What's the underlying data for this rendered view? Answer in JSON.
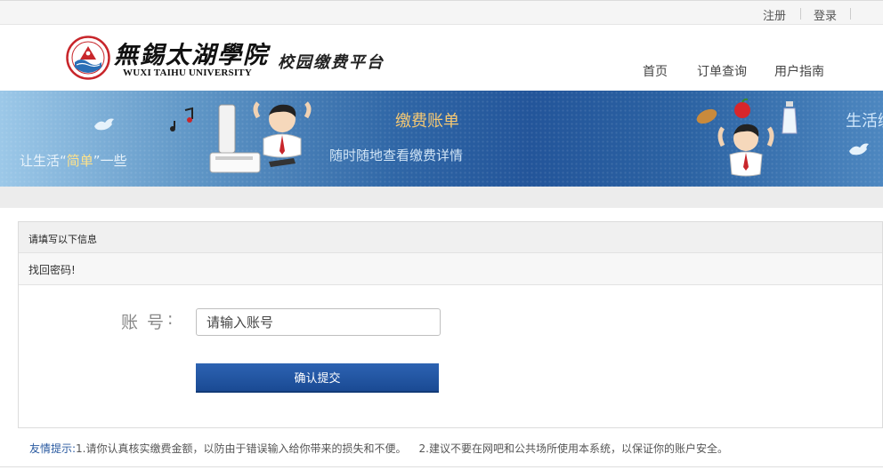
{
  "topbar": {
    "register": "注册",
    "login": "登录"
  },
  "header": {
    "logo_cn": "無錫太湖學院",
    "logo_en": "WUXI TAIHU UNIVERSITY",
    "platform": "校园缴费平台",
    "nav": [
      "首页",
      "订单查询",
      "用户指南"
    ]
  },
  "banner": {
    "tagline_prefix": "让生活“",
    "tagline_highlight": "简单",
    "tagline_suffix": "”一些",
    "title": "缴费账单",
    "subtitle": "随时随地查看缴费详情",
    "right_text": "生活缴"
  },
  "form": {
    "panel_title": "请填写以下信息",
    "section_title": "找回密码!",
    "account_label": "账号",
    "colon": ":",
    "account_placeholder": "请输入账号",
    "account_value": "",
    "submit_label": "确认提交"
  },
  "tip": {
    "label": "友情提示:",
    "item1": "1.请你认真核实缴费金额，以防由于错误输入给你带来的损失和不便。",
    "item2": "2.建议不要在网吧和公共场所使用本系统，以保证你的账户安全。"
  },
  "colors": {
    "brand_blue": "#23559a",
    "button_blue": "#1a4a94",
    "tip_blue": "#2a5aa0",
    "banner_gold": "#f5c873"
  }
}
